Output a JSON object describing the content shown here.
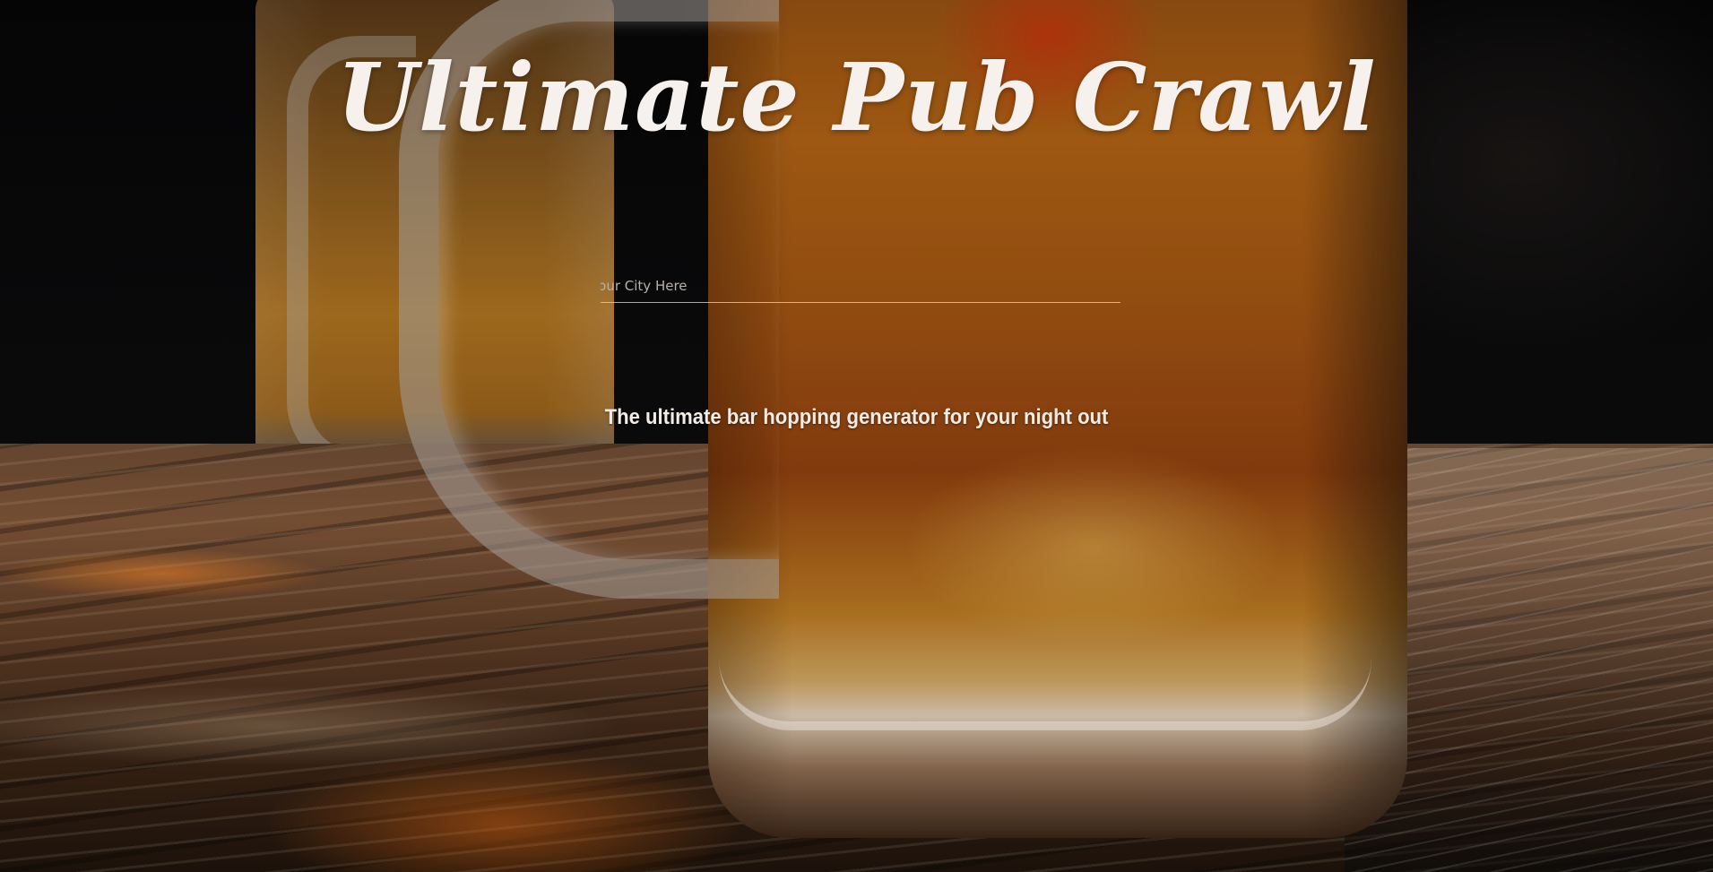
{
  "hero": {
    "title": "Ultimate Pub Crawl",
    "tagline": "The ultimate bar hopping generator for your night out"
  },
  "search": {
    "placeholder": "Your City Here",
    "value": ""
  },
  "background": {
    "description": "beer-mugs-on-wooden-table-photo"
  }
}
